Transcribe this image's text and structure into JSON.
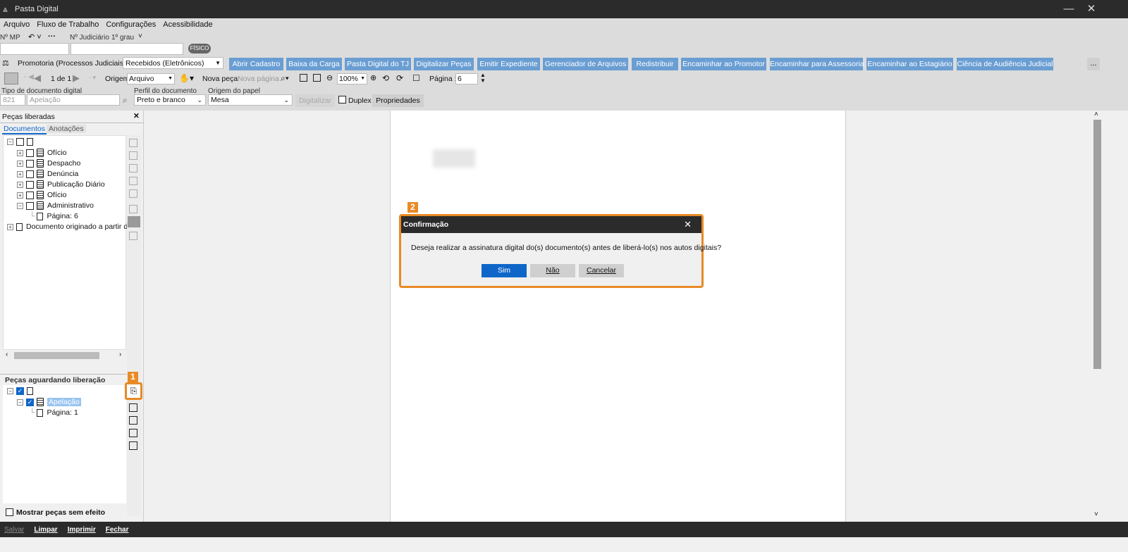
{
  "window": {
    "title": "Pasta Digital",
    "minimize": "—",
    "close": "✕"
  },
  "menu": [
    "Arquivo",
    "Fluxo de Trabalho",
    "Configurações",
    "Acessibilidade"
  ],
  "toolbar_row2": {
    "mp_label": "Nº MP",
    "judiciario_label": "Nº Judiciário",
    "grau": "1º grau",
    "fisico": "FÍSICO"
  },
  "toolbar_row3": {
    "queue_label": "Promotoria (Processos Judiciais) - Fila",
    "queue_value": "Recebidos (Eletrônicos)",
    "buttons": [
      "Abrir Cadastro",
      "Baixa da Carga",
      "Pasta Digital do TJ",
      "Digitalizar Peças",
      "Emitir Expediente",
      "Gerenciador de Arquivos",
      "Redistribuir",
      "Encaminhar ao Promotor",
      "Encaminhar para Assessoria",
      "Encaminhar ao Estagiário",
      "Ciência de Audiência Judicial"
    ],
    "more": "..."
  },
  "toolbar_row4": {
    "page_count": "1 de 1",
    "origem_label": "Origem",
    "origem_value": "Arquivo",
    "nova_peca": "Nova peça",
    "nova_pagina": "Nova página",
    "zoom": "100%",
    "pagina_label": "Página :",
    "pagina_value": "6"
  },
  "toolbar_row5": {
    "tipo_label": "Tipo de documento digital",
    "tipo_code": "821",
    "tipo_value": "Apelação",
    "perfil_label": "Perfil do documento",
    "perfil_value": "Preto e branco",
    "origem_papel_label": "Origem do papel",
    "origem_papel_value": "Mesa",
    "digitalizar": "Digitalizar",
    "duplex": "Duplex",
    "propriedades": "Propriedades"
  },
  "left_panel": {
    "title": "Peças liberadas",
    "close": "✕",
    "tabs": [
      "Documentos",
      "Anotações"
    ],
    "tree": [
      "Ofício",
      "Despacho",
      "Denúncia",
      "Publicação Diário",
      "Ofício",
      "Administrativo",
      "Página: 6",
      "Documento originado a partir do"
    ],
    "awaiting_title": "Peças aguardando liberação",
    "awaiting_tree": [
      "Apelação",
      "Página: 1"
    ],
    "show_no_effect": "Mostrar peças sem efeito"
  },
  "dialog": {
    "title": "Confirmação",
    "message": "Deseja realizar a assinatura digital do(s) documento(s) antes de liberá-lo(s) nos autos digitais?",
    "buttons": [
      "Sim",
      "Não",
      "Cancelar"
    ],
    "close": "✕"
  },
  "badges": [
    "1",
    "2"
  ],
  "statusbar": [
    "Salvar",
    "Limpar",
    "Imprimir",
    "Fechar"
  ],
  "colors": {
    "accent": "#e88a26",
    "primary_button": "#0f66c9",
    "toolbar_button": "#6a9ed3",
    "titlebar": "#2b2b2b"
  }
}
